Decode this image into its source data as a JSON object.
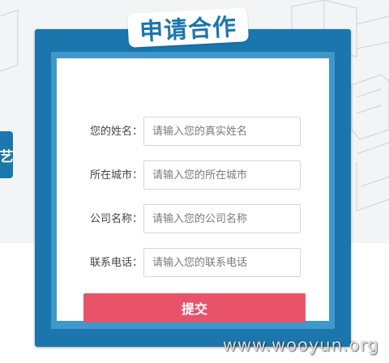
{
  "title": "申请合作",
  "side_tab": "艺",
  "form": {
    "fields": [
      {
        "label": "您的姓名：",
        "placeholder": "请输入您的真实姓名"
      },
      {
        "label": "所在城市：",
        "placeholder": "请输入您的所在城市"
      },
      {
        "label": "公司名称：",
        "placeholder": "请输入您的公司名称"
      },
      {
        "label": "联系电话：",
        "placeholder": "请输入您的联系电话"
      }
    ],
    "submit_label": "提交"
  },
  "watermark": "www.wooyun.org",
  "colors": {
    "panel": "#1a76ac",
    "panel_inner": "#3f98c9",
    "submit": "#e8536a",
    "background": "#f3f4f6"
  }
}
